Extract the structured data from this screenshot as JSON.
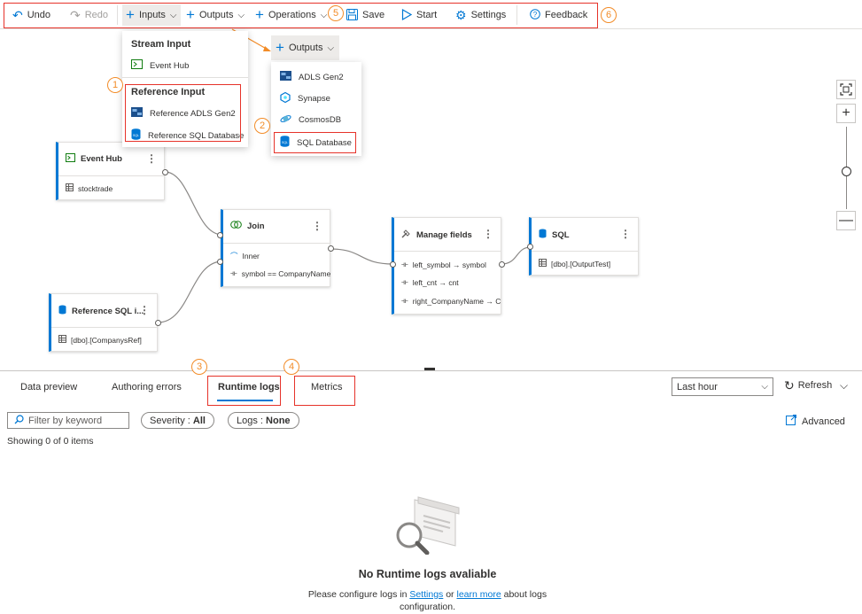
{
  "toolbar": {
    "undo": "Undo",
    "redo": "Redo",
    "inputs": "Inputs",
    "outputs": "Outputs",
    "operations": "Operations",
    "save": "Save",
    "start": "Start",
    "settings": "Settings",
    "feedback": "Feedback"
  },
  "callouts": [
    "1",
    "2",
    "3",
    "4",
    "5",
    "6"
  ],
  "inputs_menu": {
    "stream_header": "Stream Input",
    "stream_items": [
      "Event Hub"
    ],
    "reference_header": "Reference Input",
    "reference_items": [
      "Reference ADLS Gen2",
      "Reference SQL Database"
    ]
  },
  "outputs_menu": {
    "button": "Outputs",
    "items": [
      "ADLS Gen2",
      "Synapse",
      "CosmosDB",
      "SQL Database"
    ]
  },
  "nodes": {
    "event_hub": {
      "title": "Event Hub",
      "row": "stocktrade"
    },
    "reference_sql": {
      "title": "Reference SQL i...",
      "row": "[dbo].[CompanysRef]"
    },
    "join": {
      "title": "Join",
      "type": "Inner",
      "condition": "symbol == CompanyName"
    },
    "manage_fields": {
      "title": "Manage fields",
      "rows": [
        "left_symbol → symbol",
        "left_cnt → cnt",
        "right_CompanyName → Cor"
      ]
    },
    "sql": {
      "title": "SQL",
      "row": "[dbo].[OutputTest]"
    }
  },
  "panel": {
    "tabs": [
      "Data preview",
      "Authoring errors",
      "Runtime logs",
      "Metrics"
    ],
    "time_range": "Last hour",
    "refresh": "Refresh",
    "filter_placeholder": "Filter by keyword",
    "severity_label": "Severity :",
    "severity_value": "All",
    "logs_label": "Logs :",
    "logs_value": "None",
    "advanced": "Advanced",
    "count": "Showing 0 of 0 items",
    "empty_title": "No Runtime logs avaliable",
    "empty_msg_pre": "Please configure logs in",
    "empty_link_settings": "Settings",
    "empty_msg_or": "or",
    "empty_link_learn": "learn more",
    "empty_msg_post": "about logs",
    "empty_msg_line2": "configuration."
  },
  "colors": {
    "accent": "#0078d4",
    "annotation_red": "#e6332a",
    "annotation_orange": "#f28c28"
  }
}
